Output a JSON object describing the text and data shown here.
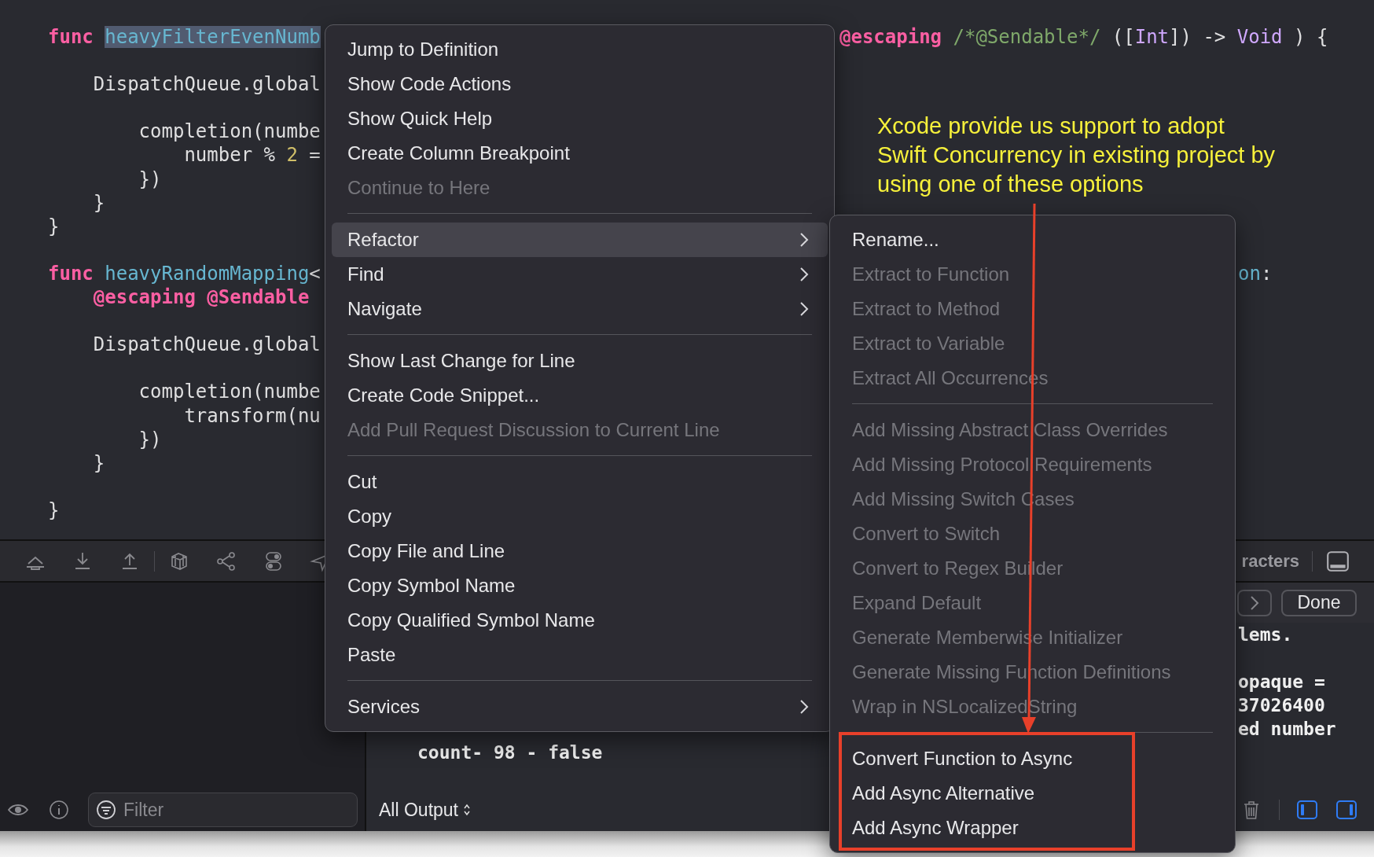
{
  "editor": {
    "lines": [
      {
        "kind": "code",
        "tokens": [
          {
            "text": "func ",
            "kind": "keyword"
          },
          {
            "text": "heavyFilterEvenNumb",
            "kind": "name",
            "highlighted": true
          }
        ],
        "tail": {
          "tokens": [
            {
              "text": "@escaping",
              "kind": "keyword"
            },
            {
              "text": " /*@Sendable*/",
              "kind": "comment"
            },
            {
              "text": " ([",
              "kind": "plain"
            },
            {
              "text": "Int",
              "kind": "type"
            },
            {
              "text": "]) -> ",
              "kind": "plain"
            },
            {
              "text": "Void",
              "kind": "type"
            },
            {
              "text": " ) {",
              "kind": "plain"
            }
          ]
        }
      },
      {
        "kind": "blank"
      },
      {
        "kind": "code",
        "tokens": [
          {
            "text": "    DispatchQueue.global",
            "kind": "plain"
          }
        ]
      },
      {
        "kind": "blank"
      },
      {
        "kind": "code",
        "tokens": [
          {
            "text": "        completion(numbe",
            "kind": "plain"
          }
        ]
      },
      {
        "kind": "code",
        "tokens": [
          {
            "text": "            number % ",
            "kind": "plain"
          },
          {
            "text": "2",
            "kind": "number"
          },
          {
            "text": " =",
            "kind": "plain"
          }
        ]
      },
      {
        "kind": "code",
        "tokens": [
          {
            "text": "        })",
            "kind": "plain"
          }
        ]
      },
      {
        "kind": "code",
        "tokens": [
          {
            "text": "    }",
            "kind": "plain"
          }
        ]
      },
      {
        "kind": "code",
        "tokens": [
          {
            "text": "}",
            "kind": "plain"
          }
        ]
      },
      {
        "kind": "blank"
      },
      {
        "kind": "code",
        "tokens": [
          {
            "text": "func ",
            "kind": "keyword"
          },
          {
            "text": "heavyRandomMapping",
            "kind": "name"
          },
          {
            "text": "<",
            "kind": "plain"
          }
        ],
        "far_tail": {
          "tokens": [
            {
              "text": "on",
              "kind": "name"
            },
            {
              "text": ":",
              "kind": "plain"
            }
          ]
        }
      },
      {
        "kind": "code",
        "tokens": [
          {
            "text": "    @escaping @Sendable",
            "kind": "keyword"
          }
        ]
      },
      {
        "kind": "blank"
      },
      {
        "kind": "code",
        "tokens": [
          {
            "text": "    DispatchQueue.global",
            "kind": "plain"
          }
        ]
      },
      {
        "kind": "blank"
      },
      {
        "kind": "code",
        "tokens": [
          {
            "text": "        completion(numbe",
            "kind": "plain"
          }
        ]
      },
      {
        "kind": "code",
        "tokens": [
          {
            "text": "            transform(nu",
            "kind": "plain"
          }
        ]
      },
      {
        "kind": "code",
        "tokens": [
          {
            "text": "        })",
            "kind": "plain"
          }
        ]
      },
      {
        "kind": "code",
        "tokens": [
          {
            "text": "    }",
            "kind": "plain"
          }
        ]
      },
      {
        "kind": "blank"
      },
      {
        "kind": "code",
        "tokens": [
          {
            "text": "}",
            "kind": "plain"
          }
        ]
      }
    ]
  },
  "toolbar": {
    "status_text": "racters"
  },
  "find_bar": {
    "done_button": "Done"
  },
  "console": {
    "left_lines": [
      "count- 98 - false"
    ],
    "right_lines": [
      {
        "kind": "text",
        "text": "lems."
      },
      {
        "kind": "blank"
      },
      {
        "kind": "text",
        "text": "opaque ="
      },
      {
        "kind": "text",
        "text": "37026400"
      },
      {
        "kind": "text",
        "text": "ed number"
      }
    ]
  },
  "filter": {
    "placeholder": "Filter"
  },
  "output_selector": {
    "label": "All Output"
  },
  "context_menu": {
    "items": [
      {
        "kind": "item",
        "label": "Jump to Definition",
        "disabled": false,
        "selected": false,
        "has_submenu": false
      },
      {
        "kind": "item",
        "label": "Show Code Actions",
        "disabled": false,
        "selected": false,
        "has_submenu": false
      },
      {
        "kind": "item",
        "label": "Show Quick Help",
        "disabled": false,
        "selected": false,
        "has_submenu": false
      },
      {
        "kind": "item",
        "label": "Create Column Breakpoint",
        "disabled": false,
        "selected": false,
        "has_submenu": false
      },
      {
        "kind": "item",
        "label": "Continue to Here",
        "disabled": true,
        "selected": false,
        "has_submenu": false
      },
      {
        "kind": "separator"
      },
      {
        "kind": "item",
        "label": "Refactor",
        "disabled": false,
        "selected": true,
        "has_submenu": true
      },
      {
        "kind": "item",
        "label": "Find",
        "disabled": false,
        "selected": false,
        "has_submenu": true
      },
      {
        "kind": "item",
        "label": "Navigate",
        "disabled": false,
        "selected": false,
        "has_submenu": true
      },
      {
        "kind": "separator"
      },
      {
        "kind": "item",
        "label": "Show Last Change for Line",
        "disabled": false,
        "selected": false,
        "has_submenu": false
      },
      {
        "kind": "item",
        "label": "Create Code Snippet...",
        "disabled": false,
        "selected": false,
        "has_submenu": false
      },
      {
        "kind": "item",
        "label": "Add Pull Request Discussion to Current Line",
        "disabled": true,
        "selected": false,
        "has_submenu": false
      },
      {
        "kind": "separator"
      },
      {
        "kind": "item",
        "label": "Cut",
        "disabled": false,
        "selected": false,
        "has_submenu": false
      },
      {
        "kind": "item",
        "label": "Copy",
        "disabled": false,
        "selected": false,
        "has_submenu": false
      },
      {
        "kind": "item",
        "label": "Copy File and Line",
        "disabled": false,
        "selected": false,
        "has_submenu": false
      },
      {
        "kind": "item",
        "label": "Copy Symbol Name",
        "disabled": false,
        "selected": false,
        "has_submenu": false
      },
      {
        "kind": "item",
        "label": "Copy Qualified Symbol Name",
        "disabled": false,
        "selected": false,
        "has_submenu": false
      },
      {
        "kind": "item",
        "label": "Paste",
        "disabled": false,
        "selected": false,
        "has_submenu": false
      },
      {
        "kind": "separator"
      },
      {
        "kind": "item",
        "label": "Services",
        "disabled": false,
        "selected": false,
        "has_submenu": true
      }
    ]
  },
  "refactor_submenu": {
    "items": [
      {
        "kind": "item",
        "label": "Rename...",
        "disabled": false,
        "selected": false
      },
      {
        "kind": "item",
        "label": "Extract to Function",
        "disabled": true,
        "selected": false
      },
      {
        "kind": "item",
        "label": "Extract to Method",
        "disabled": true,
        "selected": false
      },
      {
        "kind": "item",
        "label": "Extract to Variable",
        "disabled": true,
        "selected": false
      },
      {
        "kind": "item",
        "label": "Extract All Occurrences",
        "disabled": true,
        "selected": false
      },
      {
        "kind": "separator"
      },
      {
        "kind": "item",
        "label": "Add Missing Abstract Class Overrides",
        "disabled": true,
        "selected": false
      },
      {
        "kind": "item",
        "label": "Add Missing Protocol Requirements",
        "disabled": true,
        "selected": false
      },
      {
        "kind": "item",
        "label": "Add Missing Switch Cases",
        "disabled": true,
        "selected": false
      },
      {
        "kind": "item",
        "label": "Convert to Switch",
        "disabled": true,
        "selected": false
      },
      {
        "kind": "item",
        "label": "Convert to Regex Builder",
        "disabled": true,
        "selected": false
      },
      {
        "kind": "item",
        "label": "Expand Default",
        "disabled": true,
        "selected": false
      },
      {
        "kind": "item",
        "label": "Generate Memberwise Initializer",
        "disabled": true,
        "selected": false
      },
      {
        "kind": "item",
        "label": "Generate Missing Function Definitions",
        "disabled": true,
        "selected": false
      },
      {
        "kind": "item",
        "label": "Wrap in NSLocalizedString",
        "disabled": true,
        "selected": false
      },
      {
        "kind": "separator"
      },
      {
        "kind": "item",
        "label": "Convert Function to Async",
        "disabled": false,
        "selected": false
      },
      {
        "kind": "item",
        "label": "Add Async Alternative",
        "disabled": false,
        "selected": false
      },
      {
        "kind": "item",
        "label": "Add Async Wrapper",
        "disabled": false,
        "selected": false
      }
    ]
  },
  "annotation": {
    "text": "Xcode provide us support to adopt\nSwift Concurrency in existing project by\nusing one of these options"
  }
}
